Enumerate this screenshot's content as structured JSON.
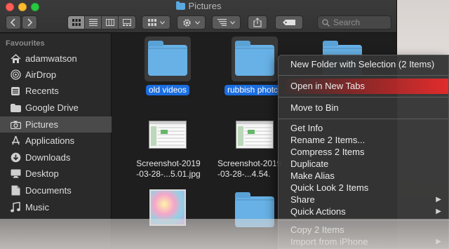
{
  "window": {
    "title": "Pictures"
  },
  "toolbar": {
    "search_placeholder": "Search"
  },
  "sidebar": {
    "heading": "Favourites",
    "items": [
      {
        "label": "adamwatson",
        "icon": "home-icon"
      },
      {
        "label": "AirDrop",
        "icon": "airdrop-icon"
      },
      {
        "label": "Recents",
        "icon": "recents-icon"
      },
      {
        "label": "Google Drive",
        "icon": "folder-icon"
      },
      {
        "label": "Pictures",
        "icon": "camera-icon",
        "selected": true
      },
      {
        "label": "Applications",
        "icon": "applications-icon"
      },
      {
        "label": "Downloads",
        "icon": "downloads-icon"
      },
      {
        "label": "Desktop",
        "icon": "desktop-icon"
      },
      {
        "label": "Documents",
        "icon": "documents-icon"
      },
      {
        "label": "Music",
        "icon": "music-icon"
      }
    ]
  },
  "files": [
    {
      "name": "old videos",
      "kind": "folder",
      "selected": true
    },
    {
      "name": "rubbish photc",
      "kind": "folder",
      "selected": true
    },
    {
      "name_line1": "Screenshot-2019",
      "name_line2": "-03-28-...5.01.jpg",
      "kind": "image"
    },
    {
      "name_line1": "Screenshot-2019",
      "name_line2": "-03-28-...4.54.",
      "kind": "image"
    }
  ],
  "context_menu": {
    "items": [
      {
        "label": "New Folder with Selection (2 Items)"
      },
      {
        "label": "Open in New Tabs",
        "highlighted": true
      },
      {
        "label": "Move to Bin"
      },
      {
        "label": "Get Info"
      },
      {
        "label": "Rename 2 Items..."
      },
      {
        "label": "Compress 2 Items"
      },
      {
        "label": "Duplicate"
      },
      {
        "label": "Make Alias"
      },
      {
        "label": "Quick Look 2 Items"
      },
      {
        "label": "Share",
        "submenu": true
      },
      {
        "label": "Quick Actions",
        "submenu": true
      },
      {
        "label": "Copy 2 Items"
      },
      {
        "label": "Import from iPhone",
        "submenu": true
      }
    ],
    "highlight_color": "#ff2a2a"
  },
  "colors": {
    "folder": "#67b1e6",
    "selection": "#1b6ee0"
  }
}
